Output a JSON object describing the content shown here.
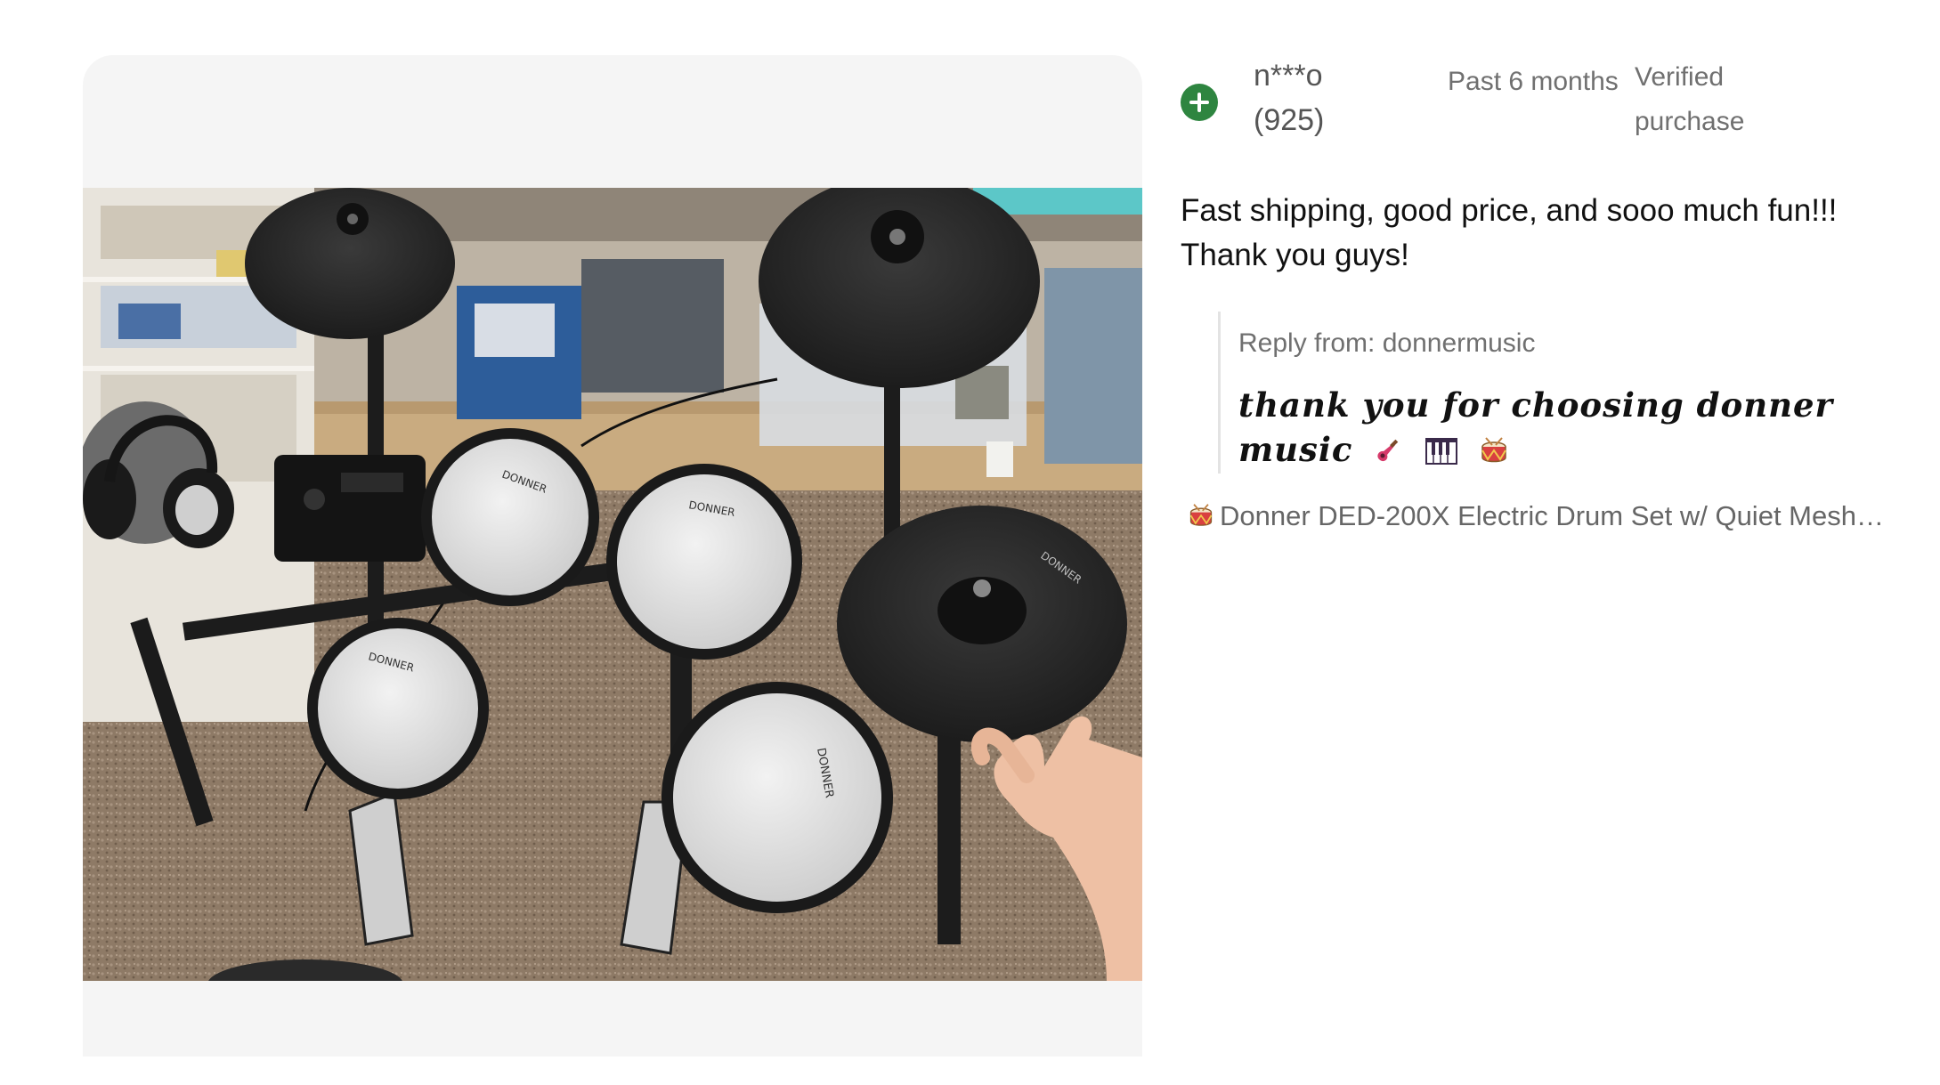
{
  "review": {
    "username": "n***o",
    "rating_count": "(925)",
    "date": "Past 6 months",
    "verified": "Verified purchase",
    "body": "Fast shipping, good price, and sooo much fun!!! Thank you guys!",
    "reply_label": "Reply from: donnermusic",
    "reply_text": "thank you for choosing donner music",
    "product": "Donner DED-200X Electric Drum Set w/ Quiet Mesh…",
    "feedback_icon": "positive-plus-icon",
    "reply_emojis": [
      "guitar",
      "piano-keys",
      "drum"
    ]
  },
  "colors": {
    "positive": "#2e8540",
    "muted_text": "#707070",
    "photo_background": "#f5f5f5"
  },
  "photo": {
    "brand_mark": "DONNER"
  }
}
